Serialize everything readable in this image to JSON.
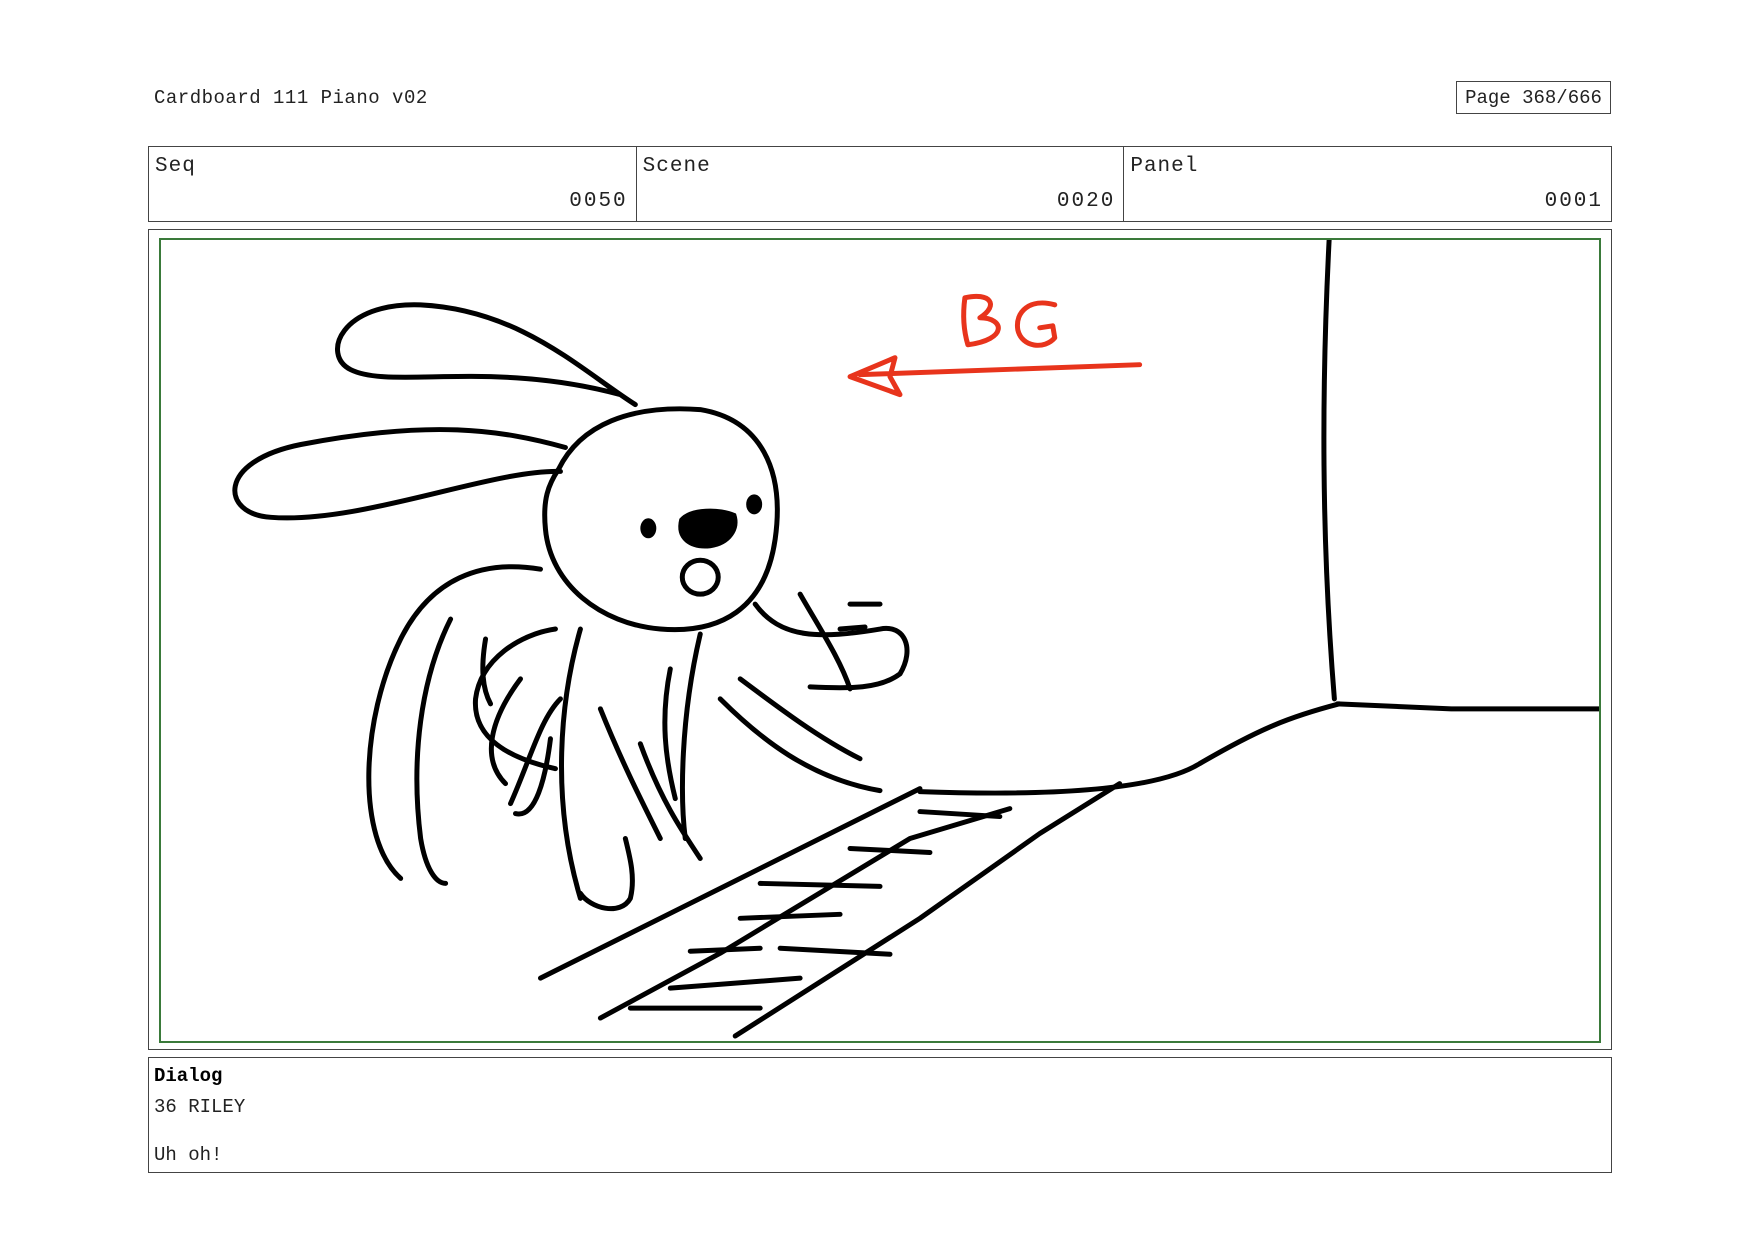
{
  "header": {
    "title": "Cardboard 111 Piano v02",
    "page": "Page 368/666"
  },
  "info": {
    "seq_label": "Seq",
    "seq_value": "0050",
    "scene_label": "Scene",
    "scene_value": "0020",
    "panel_label": "Panel",
    "panel_value": "0001"
  },
  "panel": {
    "annotation": "BG",
    "annotation_color": "#e8341c",
    "frame_color": "#3a7a3a"
  },
  "dialog": {
    "heading": "Dialog",
    "speaker": "36 RILEY",
    "line": "Uh oh!"
  }
}
